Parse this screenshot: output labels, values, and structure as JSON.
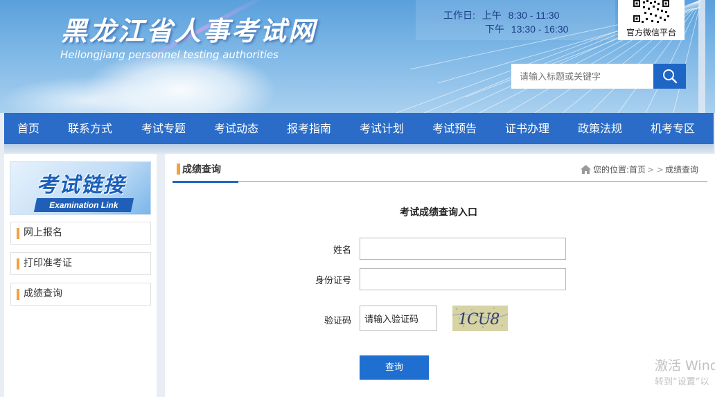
{
  "header": {
    "logo_cn": "黑龙江省人事考试网",
    "logo_en": "Heilongjiang personnel testing authorities",
    "hours": {
      "label": "工作日:",
      "am_label": "上午",
      "am_time": "8:30 - 11:30",
      "pm_label": "下午",
      "pm_time": "13:30 - 16:30"
    },
    "qr_label": "官方微信平台",
    "search_placeholder": "请输入标题或关键字"
  },
  "nav": {
    "items": [
      "首页",
      "联系方式",
      "考试专题",
      "考试动态",
      "报考指南",
      "考试计划",
      "考试预告",
      "证书办理",
      "政策法规",
      "机考专区"
    ]
  },
  "sidebar": {
    "banner_cn": "考试链接",
    "banner_en": "Examination Link",
    "links": [
      "网上报名",
      "打印准考证",
      "成绩查询"
    ]
  },
  "main": {
    "section_title": "成绩查询",
    "breadcrumb": {
      "prefix": "您的位置:",
      "home": "首页",
      "separator": "> >",
      "current": "成绩查询"
    },
    "form": {
      "title": "考试成绩查询入口",
      "name_label": "姓名",
      "name_value": "",
      "id_label": "身份证号",
      "id_value": "",
      "captcha_label": "验证码",
      "captcha_value": "请输入验证码",
      "captcha_text": "1CU8",
      "submit_label": "查询"
    }
  },
  "watermark": {
    "line1": "激活 Wind",
    "line2": "转到“设置”以"
  },
  "colors": {
    "nav_blue": "#2a6cc7",
    "accent_orange": "#f4a23d",
    "button_blue": "#1e6fcf"
  }
}
